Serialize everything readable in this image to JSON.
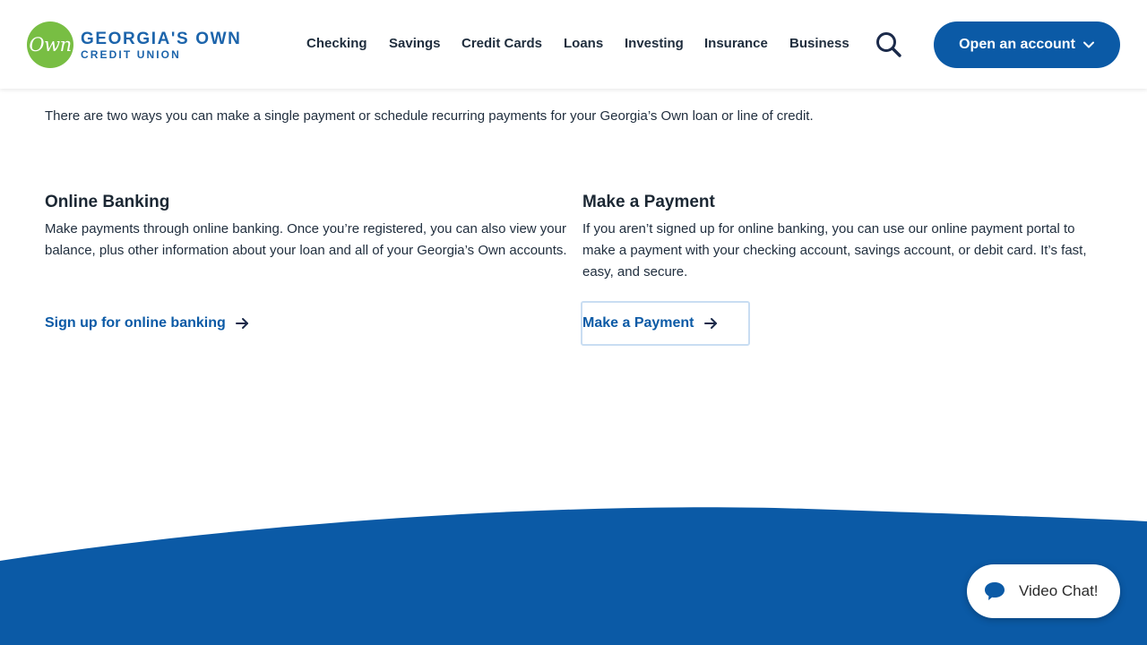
{
  "header": {
    "logo": {
      "badge_text": "Own",
      "line1": "GEORGIA'S OWN",
      "line2": "CREDIT UNION"
    },
    "nav": [
      {
        "label": "Checking"
      },
      {
        "label": "Savings"
      },
      {
        "label": "Credit Cards"
      },
      {
        "label": "Loans"
      },
      {
        "label": "Investing"
      },
      {
        "label": "Insurance"
      },
      {
        "label": "Business"
      }
    ],
    "search_icon": "search-icon",
    "open_account_label": "Open an account"
  },
  "main": {
    "intro": "There are two ways you can make a single payment or schedule recurring payments for your Georgia’s Own loan or line of credit.",
    "online_banking": {
      "heading": "Online Banking",
      "body": "Make payments through online banking. Once you’re registered, you can also view your balance, plus other information about your loan and all of your Georgia’s Own accounts.",
      "link": "Sign up for online banking"
    },
    "make_payment": {
      "heading": "Make a Payment",
      "body": "If you aren’t signed up for online banking, you can use our online payment portal to make a payment with your checking account, savings account, or debit card. It’s fast, easy, and secure.",
      "link": "Make a Payment"
    }
  },
  "chat": {
    "label": "Video Chat!",
    "icon": "chat-bubble-icon"
  },
  "colors": {
    "brand_blue": "#0b5aa6",
    "logo_green": "#78be43",
    "wave_blue": "#0b5aa6"
  }
}
